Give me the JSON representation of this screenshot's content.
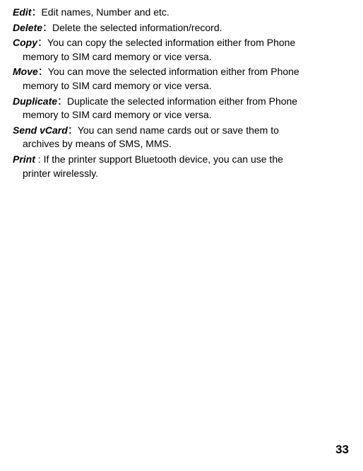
{
  "entries": [
    {
      "term": "Edit",
      "sep": "：",
      "desc": "Edit names, Number and etc.",
      "cont": []
    },
    {
      "term": "Delete",
      "sep": "：",
      "desc": "Delete the selected information/record.",
      "cont": []
    },
    {
      "term": "Copy",
      "sep": "：",
      "desc": "You can copy the selected information either from Phone",
      "cont": [
        "memory to SIM card memory or vice versa."
      ]
    },
    {
      "term": "Move",
      "sep": "：",
      "desc": "You can move the selected information either from Phone",
      "cont": [
        "memory to SIM card memory or vice versa."
      ]
    },
    {
      "term": "Duplicate",
      "sep": "：",
      "desc": "Duplicate the selected information either from Phone",
      "cont": [
        "memory to SIM card memory or vice versa."
      ]
    },
    {
      "term": "Send vCard",
      "sep": "：",
      "desc": "You can send name cards out or save them to",
      "cont": [
        "archives by means of SMS, MMS."
      ]
    },
    {
      "term": "Print",
      "sep": " : ",
      "desc": "If the printer support Bluetooth device, you can use the",
      "cont": [
        "printer wirelessly."
      ]
    }
  ],
  "pageNumber": "33"
}
